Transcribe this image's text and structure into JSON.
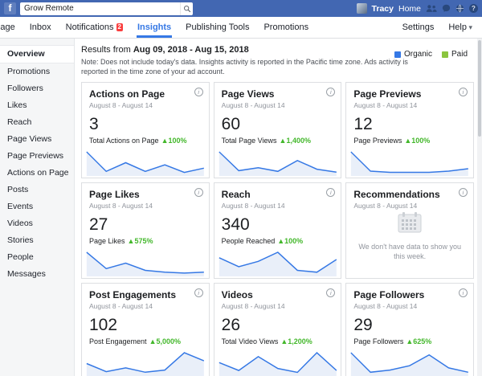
{
  "colors": {
    "header_blue": "#4267b2",
    "accent_blue": "#3578e5",
    "positive_green": "#42b72a",
    "paid_green": "#8bc53f",
    "badge_red": "#fa3e3e",
    "spark_line": "#3578e5",
    "spark_fill": "#e9eff9"
  },
  "topbar": {
    "search_value": "Grow Remote",
    "user_name": "Tracy",
    "home_label": "Home"
  },
  "nav": {
    "tabs": [
      {
        "label": "Page"
      },
      {
        "label": "Inbox"
      },
      {
        "label": "Notifications",
        "badge": "2"
      },
      {
        "label": "Insights"
      },
      {
        "label": "Publishing Tools"
      },
      {
        "label": "Promotions"
      }
    ],
    "settings_label": "Settings",
    "help_label": "Help"
  },
  "sidebar": {
    "items": [
      "Overview",
      "Promotions",
      "Followers",
      "Likes",
      "Reach",
      "Page Views",
      "Page Previews",
      "Actions on Page",
      "Posts",
      "Events",
      "Videos",
      "Stories",
      "People",
      "Messages"
    ],
    "active_item": "Overview"
  },
  "summary": {
    "results_prefix": "Results from",
    "date_range": "Aug 09, 2018 - Aug 15, 2018",
    "note": "Note: Does not include today's data. Insights activity is reported in the Pacific time zone. Ads activity is reported in the time zone of your ad account.",
    "legend": {
      "organic_label": "Organic",
      "paid_label": "Paid"
    }
  },
  "cards": [
    {
      "title": "Actions on Page",
      "period": "August 8 - August 14",
      "value": "3",
      "metric": "Total Actions on Page",
      "change": "▲100%",
      "spark": [
        2,
        0.2,
        1,
        0.2,
        0.8,
        0.1,
        0.5
      ]
    },
    {
      "title": "Page Views",
      "period": "August 8 - August 14",
      "value": "60",
      "metric": "Total Page Views",
      "change": "▲1,400%",
      "spark": [
        30,
        4,
        8,
        3,
        18,
        6,
        2
      ]
    },
    {
      "title": "Page Previews",
      "period": "August 8 - August 14",
      "value": "12",
      "metric": "Page Previews",
      "change": "▲100%",
      "spark": [
        9,
        1,
        0.5,
        0.5,
        0.5,
        1,
        2
      ]
    },
    {
      "title": "Page Likes",
      "period": "August 8 - August 14",
      "value": "27",
      "metric": "Page Likes",
      "change": "▲575%",
      "spark": [
        12,
        3,
        6,
        2,
        1,
        0.5,
        1
      ]
    },
    {
      "title": "Reach",
      "period": "August 8 - August 14",
      "value": "340",
      "metric": "People Reached",
      "change": "▲100%",
      "spark": [
        90,
        40,
        70,
        120,
        20,
        10,
        80
      ]
    },
    {
      "title": "Post Engagements",
      "period": "August 8 - August 14",
      "value": "102",
      "metric": "Post Engagement",
      "change": "▲5,000%",
      "spark": [
        20,
        5,
        12,
        4,
        8,
        40,
        25
      ]
    },
    {
      "title": "Videos",
      "period": "August 8 - August 14",
      "value": "26",
      "metric": "Total Video Views",
      "change": "▲1,200%",
      "spark": [
        6,
        2,
        9,
        3,
        1,
        11,
        2
      ]
    },
    {
      "title": "Page Followers",
      "period": "August 8 - August 14",
      "value": "29",
      "metric": "Page Followers",
      "change": "▲625%",
      "spark": [
        10,
        1,
        2,
        4,
        9,
        3,
        1
      ]
    }
  ],
  "reco_card": {
    "title": "Recommendations",
    "period": "August 8 - August 14",
    "empty_text": "We don't have data to show you this week."
  }
}
